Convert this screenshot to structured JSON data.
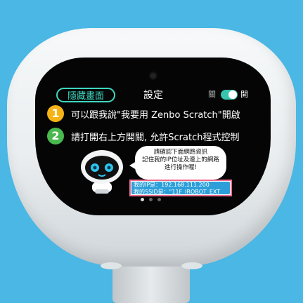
{
  "header": {
    "hide_button": "隱藏畫面",
    "title": "設定",
    "switch_off": "關",
    "switch_on": "開"
  },
  "steps": [
    {
      "number": "1",
      "text": "可以跟我說\"我要用 Zenbo Scratch\"開啟"
    },
    {
      "number": "2",
      "text": "請打開右上方開關, 允許Scratch程式控制"
    }
  ],
  "bubble": {
    "line1": "請確認下面網路資訊",
    "line2": "記住我的IP位址及連上的網路",
    "line3": "進行操作喔!"
  },
  "network": {
    "ip": "我的IP是：192.168.111.200",
    "ssid": "我的SSID是：\"11F_IROBOT_EXT"
  },
  "pager": {
    "count": 3,
    "active_index": 0
  },
  "colors": {
    "background": "#4ab7e4",
    "accent": "#3fd7bf",
    "step1": "#f5b316",
    "step2": "#49b84e",
    "highlight_border": "#f36a8d",
    "info_fill": "#2c9fd9"
  }
}
